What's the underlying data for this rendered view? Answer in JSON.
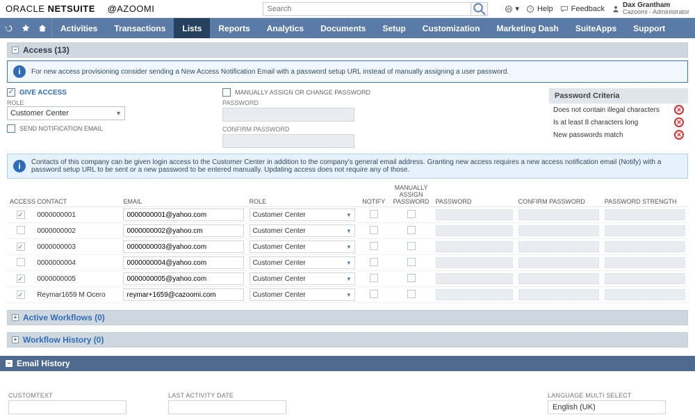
{
  "brand": {
    "oracle": "ORACLE",
    "netsuite": "NETSUITE",
    "cazoomi": "AZOOMI"
  },
  "search": {
    "placeholder": "Search"
  },
  "header": {
    "help": "Help",
    "feedback": "Feedback",
    "user_name": "Dax Grantham",
    "user_role": "Cazoomi - Administrator"
  },
  "nav": {
    "items": [
      "Activities",
      "Transactions",
      "Lists",
      "Reports",
      "Analytics",
      "Documents",
      "Setup",
      "Customization",
      "Marketing Dash",
      "SuiteApps",
      "Support"
    ],
    "active": "Lists"
  },
  "section": {
    "access_title": "Access (13)"
  },
  "info1": "For new access provisioning consider sending a New Access Notification Email with a password setup URL instead of manually assigning a user password.",
  "form": {
    "give_access": "GIVE ACCESS",
    "role_label": "ROLE",
    "role_value": "Customer Center",
    "send_notification": "SEND NOTIFICATION EMAIL",
    "manual_assign": "MANUALLY ASSIGN OR CHANGE PASSWORD",
    "password_label": "PASSWORD",
    "confirm_password_label": "CONFIRM PASSWORD"
  },
  "criteria": {
    "title": "Password Criteria",
    "items": [
      "Does not contain illegal characters",
      "Is at least 8 characters long",
      "New passwords match"
    ]
  },
  "info2": "Contacts of this company can be given login access to the Customer Center in addition to the company's general email address. Granting new access requires a new access notification email (Notify) with a password setup URL to be sent or a new password to be entered manually. Updating access does not require any of those.",
  "table": {
    "headers": {
      "access": "ACCESS",
      "contact": "CONTACT",
      "email": "EMAIL",
      "role": "ROLE",
      "notify": "NOTIFY",
      "map": "MANUALLY ASSIGN PASSWORD",
      "password": "PASSWORD",
      "confirm": "CONFIRM PASSWORD",
      "strength": "PASSWORD STRENGTH"
    },
    "rows": [
      {
        "access": true,
        "contact": "0000000001",
        "email": "0000000001@yahoo.com",
        "role": "Customer Center"
      },
      {
        "access": false,
        "contact": "0000000002",
        "email": "0000000002@yahoo.cm",
        "role": "Customer Center"
      },
      {
        "access": true,
        "contact": "0000000003",
        "email": "0000000003@yahoo.com",
        "role": "Customer Center"
      },
      {
        "access": false,
        "contact": "0000000004",
        "email": "0000000004@yahoo.com",
        "role": "Customer Center"
      },
      {
        "access": true,
        "contact": "0000000005",
        "email": "0000000005@yahoo.com",
        "role": "Customer Center"
      },
      {
        "access": true,
        "contact": "Reymar1659 M Ocero",
        "email": "reymar+1659@cazoomi.com",
        "role": "Customer Center"
      }
    ]
  },
  "bars": {
    "active_wf": "Active Workflows (0)",
    "wf_history": "Workflow History (0)",
    "email_history": "Email History"
  },
  "eh": {
    "customtext": "CUSTOMTEXT",
    "last_activity": "LAST ACTIVITY DATE",
    "lang_multi": "LANGUAGE MULTI SELECT",
    "lang_value": "English (UK)"
  }
}
